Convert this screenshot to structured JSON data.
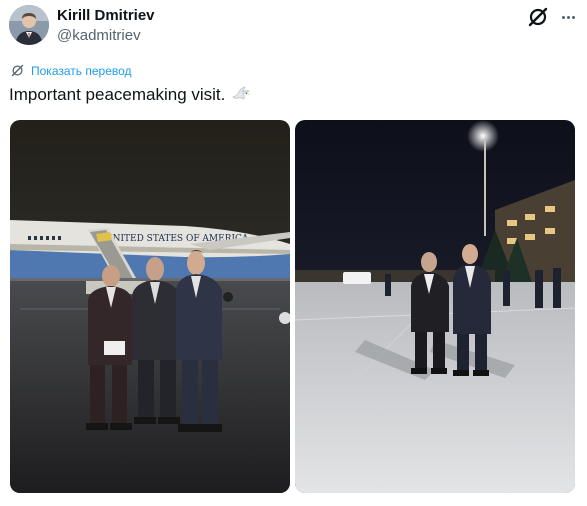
{
  "author": {
    "name": "Kirill Dmitriev",
    "handle": "@kadmitriev"
  },
  "translate": {
    "label": "Показать перевод"
  },
  "tweet": {
    "text": "Important peacemaking visit.",
    "emoji_icon": "dove-icon"
  },
  "photos": [
    {
      "aircraft_text": "UNITED STATES OF AMERICA"
    },
    {
      "scene": "night-apron"
    }
  ],
  "icons": {
    "grok": "grok-icon",
    "more": "more-icon",
    "translate": "translate-icon"
  },
  "colors": {
    "link": "#1d9bf0",
    "text": "#0f1419",
    "muted": "#536471"
  }
}
